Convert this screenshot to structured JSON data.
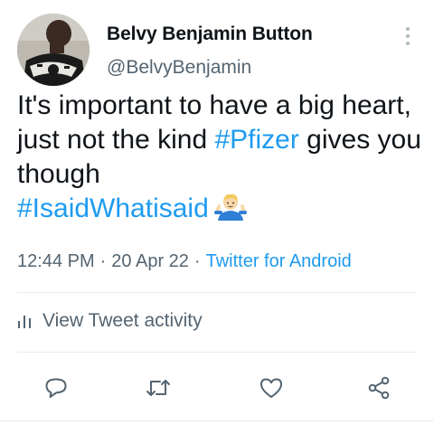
{
  "author": {
    "display_name": "Belvy Benjamin Button",
    "handle": "@BelvyBenjamin"
  },
  "tweet": {
    "text_part1": "It's important to have a big heart, just not the kind ",
    "hashtag1": "#Pfizer",
    "text_part2": " gives you though",
    "hashtag2": "#IsaidWhatisaid",
    "emoji": "man-shrugging"
  },
  "meta": {
    "time": "12:44 PM",
    "separator": "·",
    "date": "20 Apr 22",
    "source": "Twitter for Android"
  },
  "activity": {
    "label": "View Tweet activity",
    "icon": "bar-chart-icon"
  },
  "actions": [
    {
      "name": "reply",
      "icon": "reply-icon"
    },
    {
      "name": "retweet",
      "icon": "retweet-icon"
    },
    {
      "name": "like",
      "icon": "heart-icon"
    },
    {
      "name": "share",
      "icon": "share-icon"
    }
  ],
  "colors": {
    "link": "#1d9bf0",
    "secondary": "#536471",
    "icon": "#536471",
    "divider": "#e6ecf0"
  }
}
